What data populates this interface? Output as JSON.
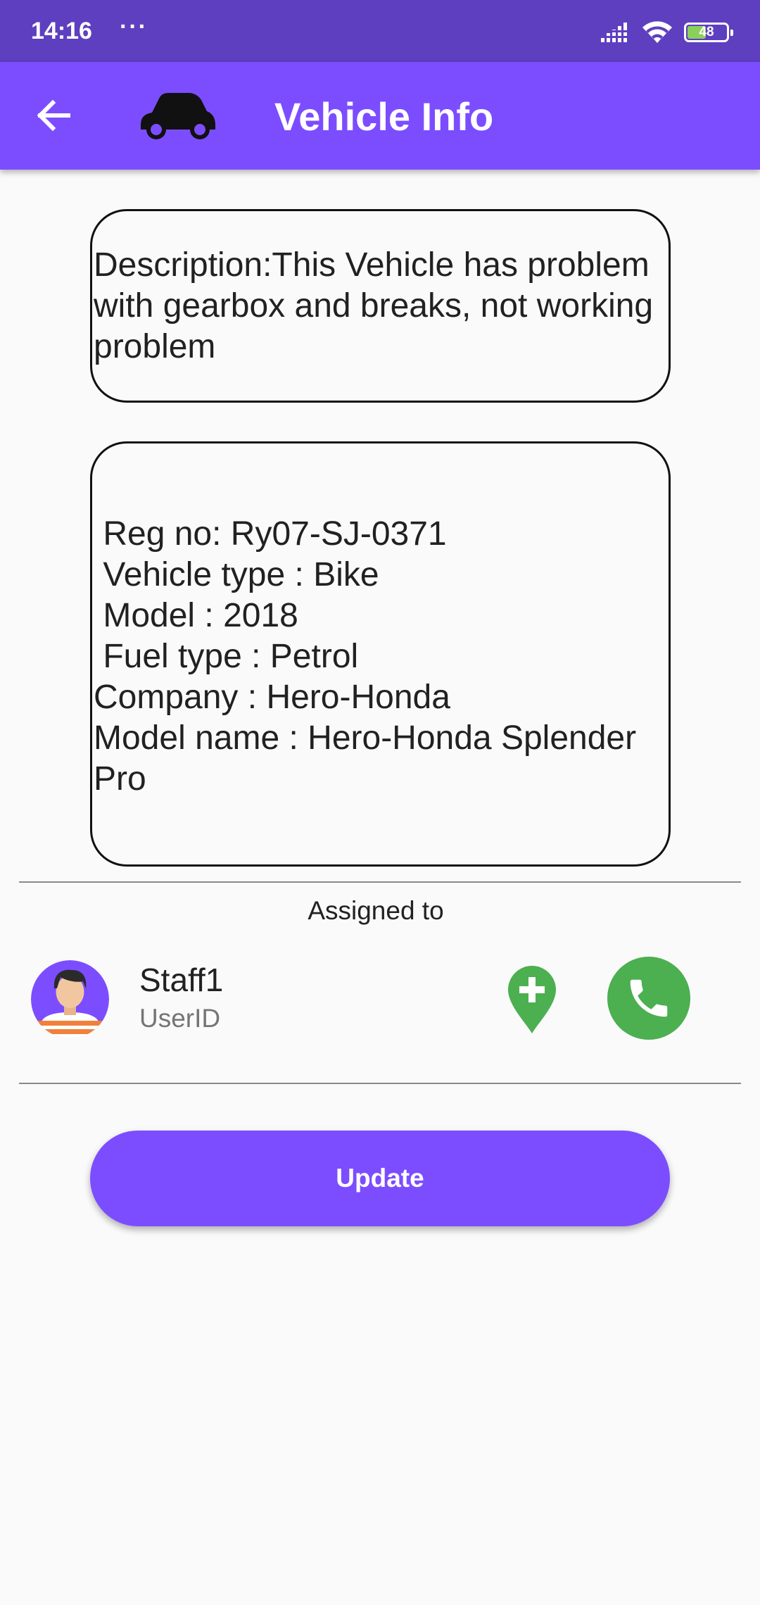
{
  "status_bar": {
    "time": "14:16",
    "dots": "···",
    "battery": "48",
    "battery_level_percent": 48,
    "icons": [
      "signal-icon",
      "wifi-icon",
      "battery-icon"
    ]
  },
  "app_bar": {
    "title": "Vehicle Info",
    "back_icon": "arrow-left-icon",
    "car_icon": "car-icon",
    "color": "#7c4dff"
  },
  "description": {
    "text": "Description:This Vehicle has problem with gearbox and breaks, not working problem"
  },
  "vehicle": {
    "lines": [
      " Reg no: Ry07-SJ-0371",
      " Vehicle type : Bike",
      " Model : 2018",
      " Fuel type : Petrol",
      "Company : Hero-Honda",
      "Model name : Hero-Honda Splender Pro"
    ]
  },
  "assignment": {
    "label": "Assigned to",
    "staff_name": "Staff1",
    "staff_sub": "UserID",
    "location_icon": "add-location-icon",
    "call_icon": "phone-icon",
    "accent_green": "#4caf50"
  },
  "actions": {
    "update_label": "Update"
  }
}
